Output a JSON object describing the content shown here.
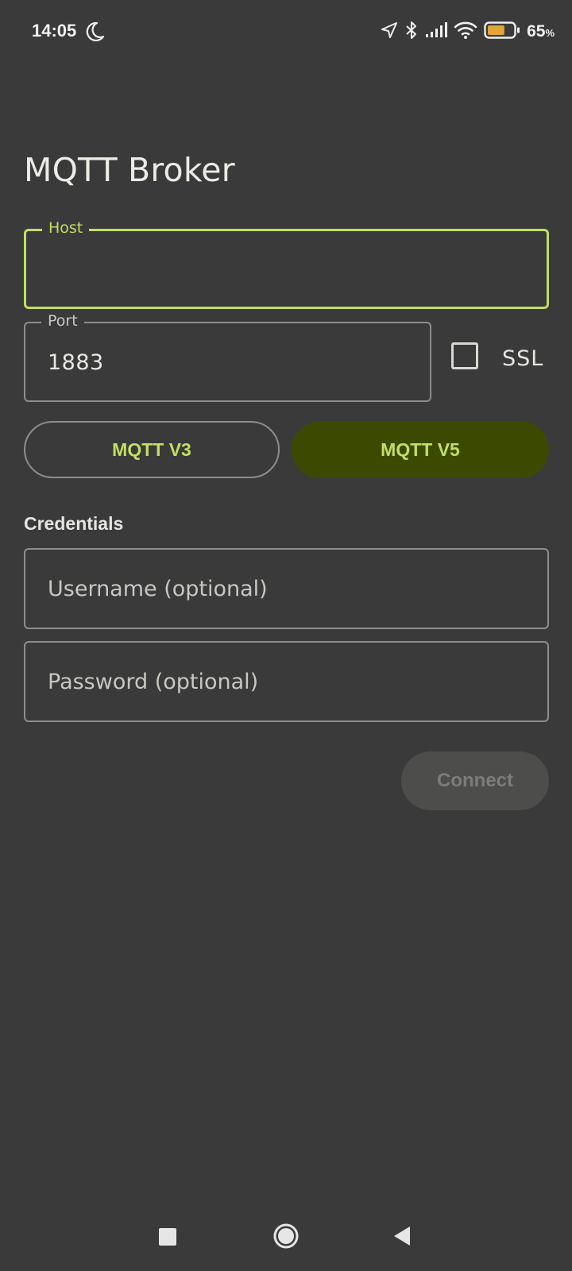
{
  "status_bar": {
    "time": "14:05",
    "battery_percent": "65",
    "battery_unit": "%",
    "battery_level": 0.65,
    "icons": [
      "moon-icon",
      "location-arrow-icon",
      "bluetooth-icon",
      "cellular-signal-icon",
      "wifi-icon",
      "battery-icon"
    ]
  },
  "page": {
    "title": "MQTT Broker"
  },
  "form": {
    "host": {
      "label": "Host",
      "value": ""
    },
    "port": {
      "label": "Port",
      "value": "1883"
    },
    "ssl": {
      "label": "SSL",
      "checked": false
    },
    "protocol": {
      "options": [
        "MQTT V3",
        "MQTT V5"
      ],
      "selected": "MQTT V5"
    },
    "credentials": {
      "section_title": "Credentials",
      "username_placeholder": "Username (optional)",
      "password_placeholder": "Password (optional)"
    },
    "connect_label": "Connect"
  },
  "nav_bar": {
    "icons": [
      "recents-square-icon",
      "home-circle-icon",
      "back-triangle-icon"
    ]
  },
  "colors": {
    "background": "#3a3a3a",
    "accent": "#c1df63",
    "selected_segment": "#3b4a00",
    "disabled_button": "#4d4d4c"
  }
}
